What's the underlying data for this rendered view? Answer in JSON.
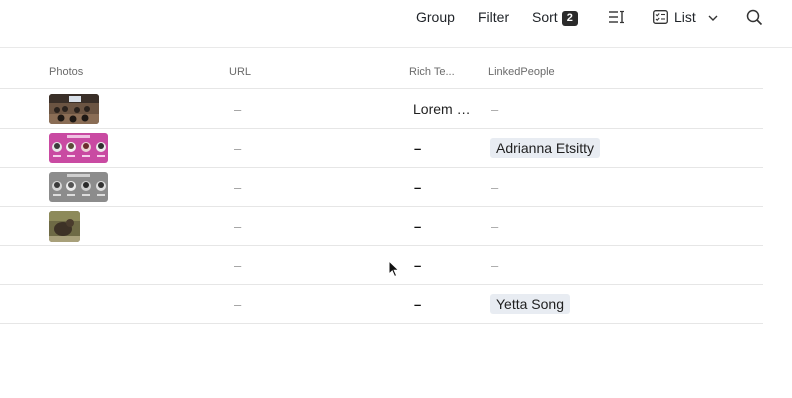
{
  "toolbar": {
    "group_label": "Group",
    "filter_label": "Filter",
    "sort_label": "Sort",
    "sort_count": "2",
    "view_label": "List",
    "icons": [
      "row-height-icon",
      "list-view-icon",
      "chevron-down-icon",
      "search-icon"
    ]
  },
  "columns": {
    "photos": "Photos",
    "url": "URL",
    "rich_text": "Rich Te...",
    "linked_people": "LinkedPeople"
  },
  "rows": [
    {
      "photo": "conference-room-photo",
      "url": "–",
      "rich_text": "Lorem i...",
      "people": "–"
    },
    {
      "photo": "pink-people-card",
      "url": "–",
      "rich_text": "–",
      "people": "Adrianna Etsitty"
    },
    {
      "photo": "gray-people-card",
      "url": "–",
      "rich_text": "–",
      "people": "–"
    },
    {
      "photo": "animal-photo",
      "url": "–",
      "rich_text": "–",
      "people": "–"
    },
    {
      "photo": "",
      "url": "–",
      "rich_text": "–",
      "people": "–"
    },
    {
      "photo": "",
      "url": "–",
      "rich_text": "–",
      "people": "Yetta Song"
    }
  ],
  "colors": {
    "chip_bg": "#e8ecf2",
    "border": "#e6e6e6",
    "badge_bg": "#2b2b2b"
  }
}
